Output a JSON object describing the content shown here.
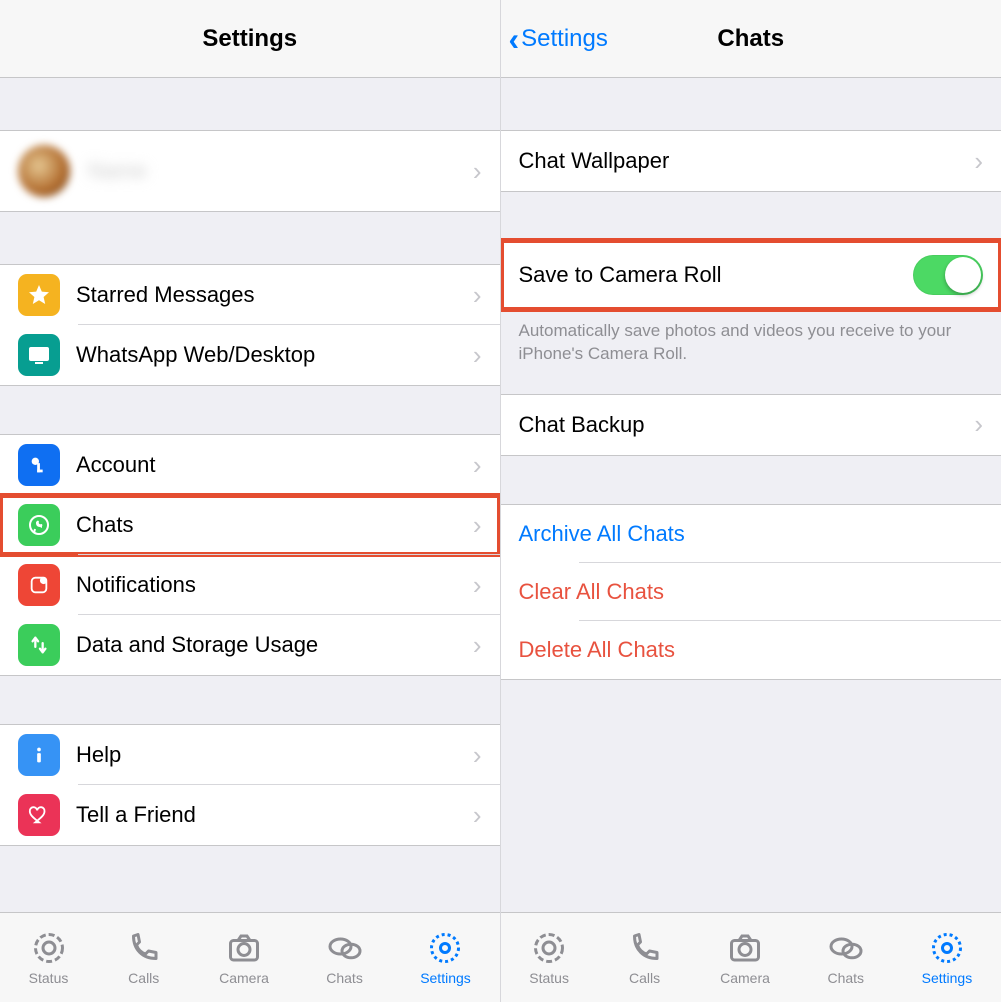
{
  "left": {
    "navTitle": "Settings",
    "profileName": "Name",
    "starred": "Starred Messages",
    "web": "WhatsApp Web/Desktop",
    "account": "Account",
    "chats": "Chats",
    "notifications": "Notifications",
    "data": "Data and Storage Usage",
    "help": "Help",
    "tell": "Tell a Friend"
  },
  "right": {
    "backLabel": "Settings",
    "navTitle": "Chats",
    "wallpaper": "Chat Wallpaper",
    "saveRoll": "Save to Camera Roll",
    "saveRollFooter": "Automatically save photos and videos you receive to your iPhone's Camera Roll.",
    "backup": "Chat Backup",
    "archive": "Archive All Chats",
    "clear": "Clear All Chats",
    "delete": "Delete All Chats"
  },
  "tabs": {
    "status": "Status",
    "calls": "Calls",
    "camera": "Camera",
    "chats": "Chats",
    "settings": "Settings"
  }
}
